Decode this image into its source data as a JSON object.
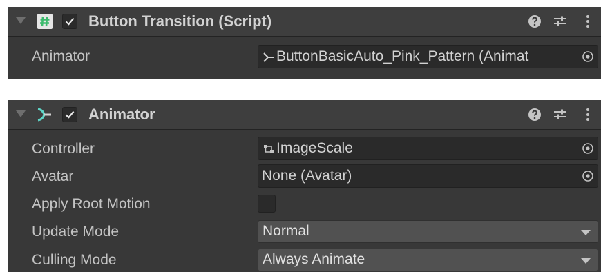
{
  "button_transition": {
    "title": "Button Transition (Script)",
    "enabled": true,
    "fields": {
      "animator": {
        "label": "Animator",
        "value": "ButtonBasicAuto_Pink_Pattern (Animat"
      }
    }
  },
  "animator": {
    "title": "Animator",
    "enabled": true,
    "fields": {
      "controller": {
        "label": "Controller",
        "value": "ImageScale"
      },
      "avatar": {
        "label": "Avatar",
        "value": "None (Avatar)"
      },
      "apply_root_motion": {
        "label": "Apply Root Motion",
        "checked": false
      },
      "update_mode": {
        "label": "Update Mode",
        "value": "Normal"
      },
      "culling_mode": {
        "label": "Culling Mode",
        "value": "Always Animate"
      }
    }
  },
  "colors": {
    "panel_bg": "#383838",
    "header_bg": "#3e3e3e",
    "script_icon_green": "#3dbb6e",
    "animator_icon_teal": "#5fd6c8"
  },
  "icons": {
    "header": [
      "foldout-arrow-icon",
      "script-hash-icon",
      "animator-icon",
      "checkbox-check-icon",
      "help-icon",
      "presets-icon",
      "more-options-icon"
    ],
    "fields": [
      "animator-controller-icon",
      "object-picker-icon",
      "dropdown-arrow-icon"
    ]
  }
}
